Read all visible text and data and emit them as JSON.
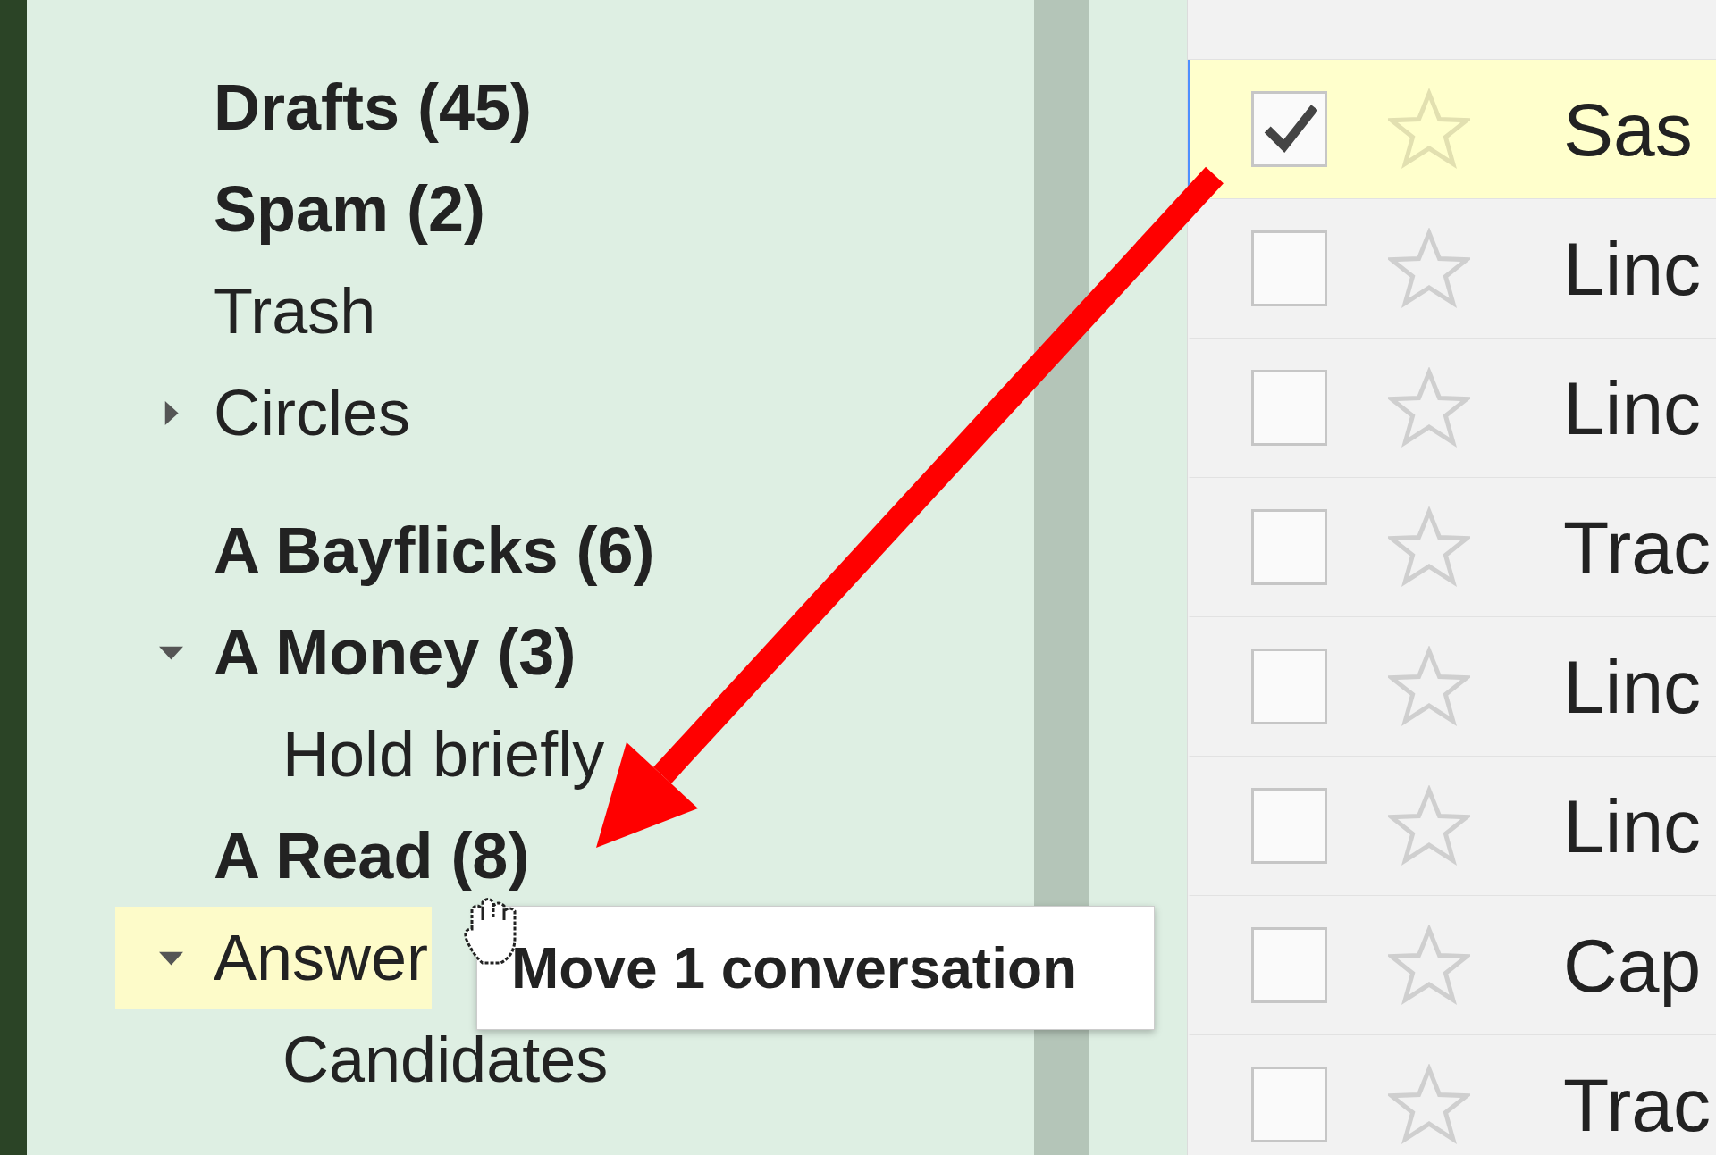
{
  "sidebar": {
    "system_labels": [
      {
        "label": "Drafts (45)",
        "bold": true,
        "highlighted": false
      },
      {
        "label": "Spam (2)",
        "bold": true,
        "highlighted": false
      },
      {
        "label": "Trash",
        "bold": false,
        "highlighted": false
      },
      {
        "label": "Circles",
        "bold": false,
        "highlighted": false,
        "expanded": false
      }
    ],
    "labels": [
      {
        "label": "A Bayflicks (6)",
        "bold": true,
        "highlighted": false
      },
      {
        "label": "A Money (3)",
        "bold": true,
        "highlighted": false,
        "expanded": true,
        "children": [
          {
            "label": "Hold briefly",
            "bold": false,
            "highlighted": false
          }
        ]
      },
      {
        "label": "A Read (8)",
        "bold": true,
        "highlighted": false
      },
      {
        "label": "Answer",
        "bold": false,
        "highlighted": true,
        "expanded": true,
        "children": [
          {
            "label": "Candidates",
            "bold": false,
            "highlighted": false
          }
        ]
      }
    ]
  },
  "mail_list": {
    "rows": [
      {
        "sender": "Sas",
        "checked": true,
        "selected": true,
        "starred": false
      },
      {
        "sender": "Linc",
        "checked": false,
        "selected": false,
        "starred": false
      },
      {
        "sender": "Linc",
        "checked": false,
        "selected": false,
        "starred": false
      },
      {
        "sender": "Trac",
        "checked": false,
        "selected": false,
        "starred": false
      },
      {
        "sender": "Linc",
        "checked": false,
        "selected": false,
        "starred": false
      },
      {
        "sender": "Linc",
        "checked": false,
        "selected": false,
        "starred": false
      },
      {
        "sender": "Cap",
        "checked": false,
        "selected": false,
        "starred": false
      },
      {
        "sender": "Trac",
        "checked": false,
        "selected": false,
        "starred": false
      }
    ]
  },
  "tooltip": {
    "text": "Move 1 conversation"
  }
}
